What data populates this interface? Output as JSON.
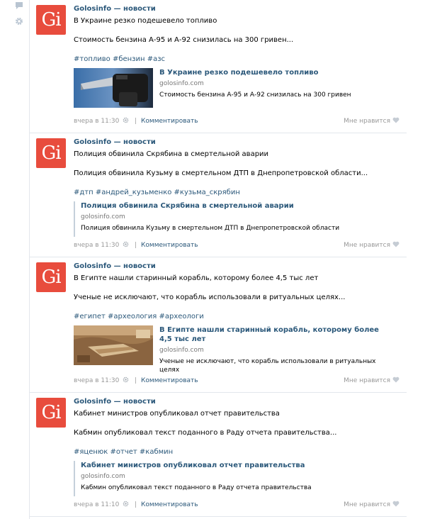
{
  "sidebar": {
    "icons": [
      "comment-icon",
      "gear-icon"
    ]
  },
  "posts": [
    {
      "author": "Golosinfo — новости",
      "text1": "В Украине резко подешевело топливо",
      "text2": "Стоимость бензина А-95 и А-92 снизилась на 300 гривен...",
      "tags": "#топливо #бензин #азс",
      "snippet": {
        "title": "В Украине резко подешевело топливо",
        "domain": "golosinfo.com",
        "desc": "Стоимость бензина А-95 и А-92 снизилась на 300 гривен",
        "image": "fuel-nozzle"
      },
      "time": "вчера в 11:30",
      "comment": "Комментировать",
      "like": "Мне нравится"
    },
    {
      "author": "Golosinfo — новости",
      "text1": "Полиция обвинила Скрябина в смертельной аварии",
      "text2": "Полиция обвинила Кузьму в смертельном ДТП в Днепропетровской области...",
      "tags": "#дтп #андрей_кузьменко #кузьма_скрябин",
      "snippet": {
        "title": "Полиция обвинила Скрябина в смертельной аварии",
        "domain": "golosinfo.com",
        "desc": "Полиция обвинила Кузьму в смертельном ДТП в Днепропетровской области"
      },
      "time": "вчера в 11:30",
      "comment": "Комментировать",
      "like": "Мне нравится"
    },
    {
      "author": "Golosinfo — новости",
      "text1": "В Египте нашли старинный корабль, которому более 4,5 тыс лет",
      "text2": "Ученые не исключают, что корабль использовали в ритуальных целях...",
      "tags": "#египет #археология #археологи",
      "snippet": {
        "title": "В Египте нашли старинный корабль, которому более 4,5 тыс лет",
        "domain": "golosinfo.com",
        "desc": "Ученые не исключают, что корабль использовали в ритуальных целях",
        "image": "excavation"
      },
      "time": "вчера в 11:30",
      "comment": "Комментировать",
      "like": "Мне нравится"
    },
    {
      "author": "Golosinfo — новости",
      "text1": "Кабинет министров опубликовал отчет правительства",
      "text2": "Кабмин опубликовал текст поданного в Раду отчета правительства...",
      "tags": "#яценюк #отчет #кабмин",
      "snippet": {
        "title": "Кабинет министров опубликовал отчет правительства",
        "domain": "golosinfo.com",
        "desc": "Кабмин опубликовал текст поданного в Раду отчета правительства"
      },
      "time": "вчера в 11:10",
      "comment": "Комментировать",
      "like": "Мне нравится"
    }
  ],
  "colors": {
    "link": "#2b587a",
    "avatar_bg": "#e84c3d",
    "muted": "#999999",
    "border": "#e3e7ec"
  }
}
